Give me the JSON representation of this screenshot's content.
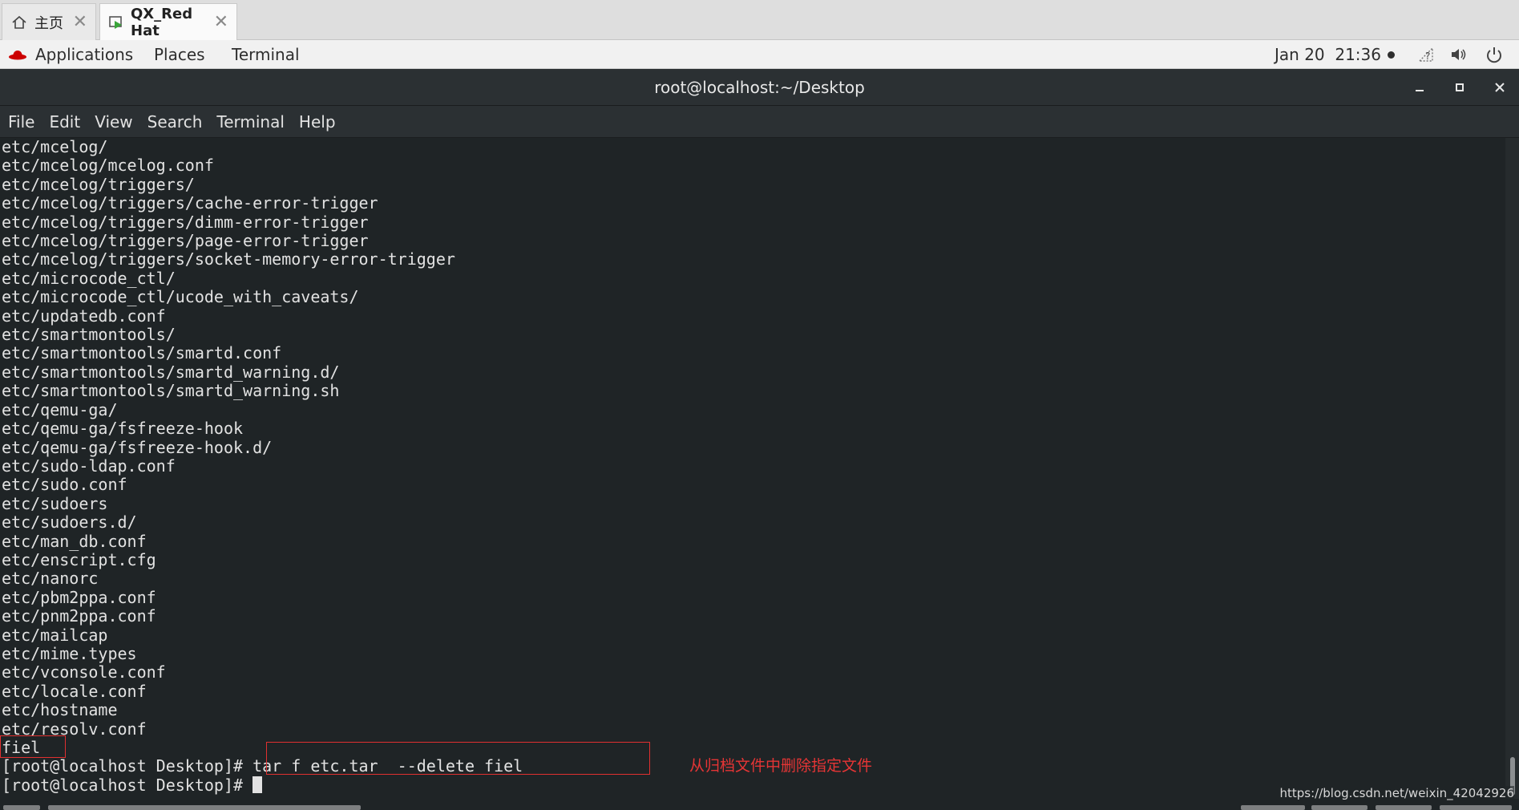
{
  "host_tabs": [
    {
      "label": "主页",
      "icon": "home-icon"
    },
    {
      "label": "QX_Red Hat",
      "icon": "vm-icon"
    }
  ],
  "topbar": {
    "applications": "Applications",
    "places": "Places",
    "terminal": "Terminal",
    "date": "Jan 20",
    "time": "21:36"
  },
  "window": {
    "title": "root@localhost:~/Desktop"
  },
  "menubar": [
    "File",
    "Edit",
    "View",
    "Search",
    "Terminal",
    "Help"
  ],
  "terminal_lines": [
    "etc/mcelog/",
    "etc/mcelog/mcelog.conf",
    "etc/mcelog/triggers/",
    "etc/mcelog/triggers/cache-error-trigger",
    "etc/mcelog/triggers/dimm-error-trigger",
    "etc/mcelog/triggers/page-error-trigger",
    "etc/mcelog/triggers/socket-memory-error-trigger",
    "etc/microcode_ctl/",
    "etc/microcode_ctl/ucode_with_caveats/",
    "etc/updatedb.conf",
    "etc/smartmontools/",
    "etc/smartmontools/smartd.conf",
    "etc/smartmontools/smartd_warning.d/",
    "etc/smartmontools/smartd_warning.sh",
    "etc/qemu-ga/",
    "etc/qemu-ga/fsfreeze-hook",
    "etc/qemu-ga/fsfreeze-hook.d/",
    "etc/sudo-ldap.conf",
    "etc/sudo.conf",
    "etc/sudoers",
    "etc/sudoers.d/",
    "etc/man_db.conf",
    "etc/enscript.cfg",
    "etc/nanorc",
    "etc/pbm2ppa.conf",
    "etc/pnm2ppa.conf",
    "etc/mailcap",
    "etc/mime.types",
    "etc/vconsole.conf",
    "etc/locale.conf",
    "etc/hostname",
    "etc/resolv.conf",
    "fiel",
    "[root@localhost Desktop]# tar f etc.tar  --delete fiel"
  ],
  "prompt": "[root@localhost Desktop]# ",
  "annotation": "从归档文件中删除指定文件",
  "watermark": "https://blog.csdn.net/weixin_42042926",
  "colors": {
    "annotation": "#e03030",
    "terminal_bg": "#1f2426",
    "terminal_fg": "#e2e2e2"
  }
}
